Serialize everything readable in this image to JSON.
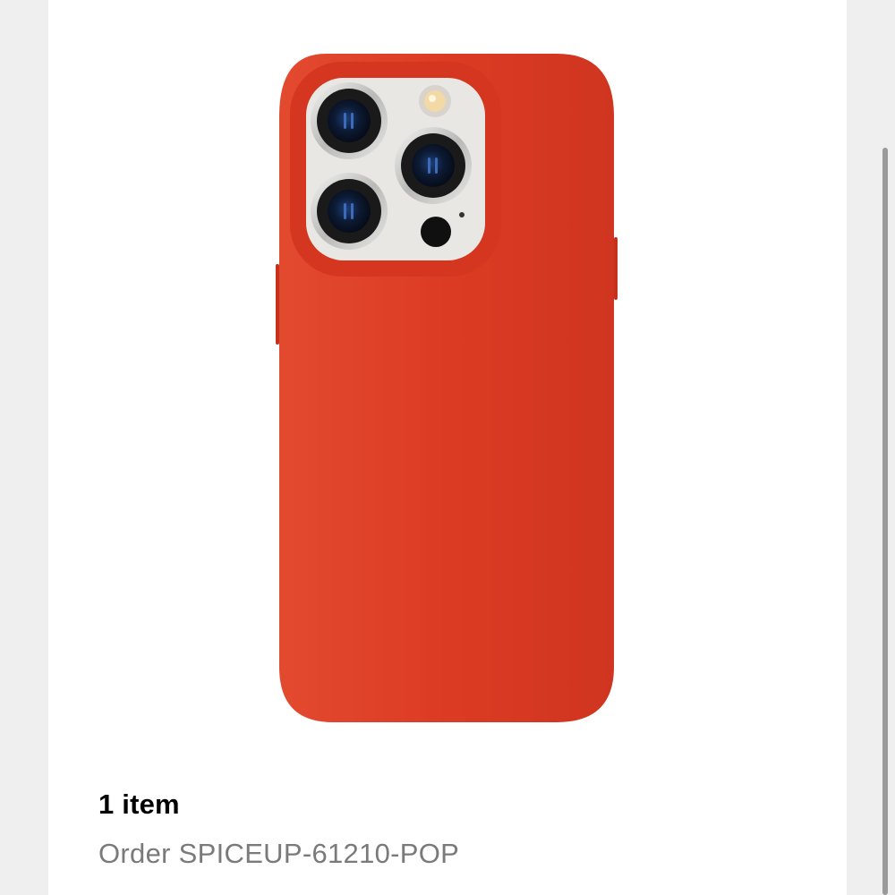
{
  "order": {
    "item_count_label": "1 item",
    "order_label": "Order SPICEUP-61210-POP"
  },
  "product": {
    "case_color": "#d93a22",
    "camera_plate_color": "#e9e7e4"
  }
}
